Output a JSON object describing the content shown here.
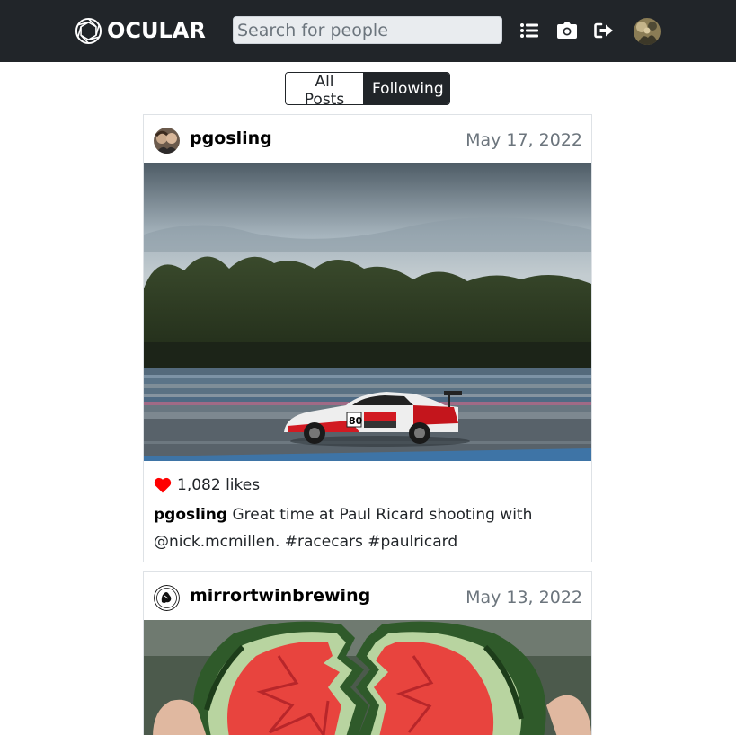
{
  "nav": {
    "brand": "OCULAR",
    "search_placeholder": "Search for people",
    "icons": [
      "aperture-logo-icon",
      "list-icon",
      "camera-icon",
      "logout-icon",
      "user-avatar"
    ],
    "background": "#212529"
  },
  "feed_toggle": {
    "all_label": "All Posts",
    "following_label": "Following",
    "active": "Following"
  },
  "posts": [
    {
      "username": "pgosling",
      "date": "May 17, 2022",
      "likes": "1,082 likes",
      "caption": "Great time at Paul Ricard shooting with @nick.mcmillen. #racecars #paulricard",
      "image": "race-car-on-track-photo"
    },
    {
      "username": "mirrortwinbrewing",
      "date": "May 13, 2022",
      "image": "split-watermelon-photo"
    }
  ],
  "colors": {
    "heart": "#ff0000",
    "muted": "#6c757d",
    "dark": "#212529"
  }
}
